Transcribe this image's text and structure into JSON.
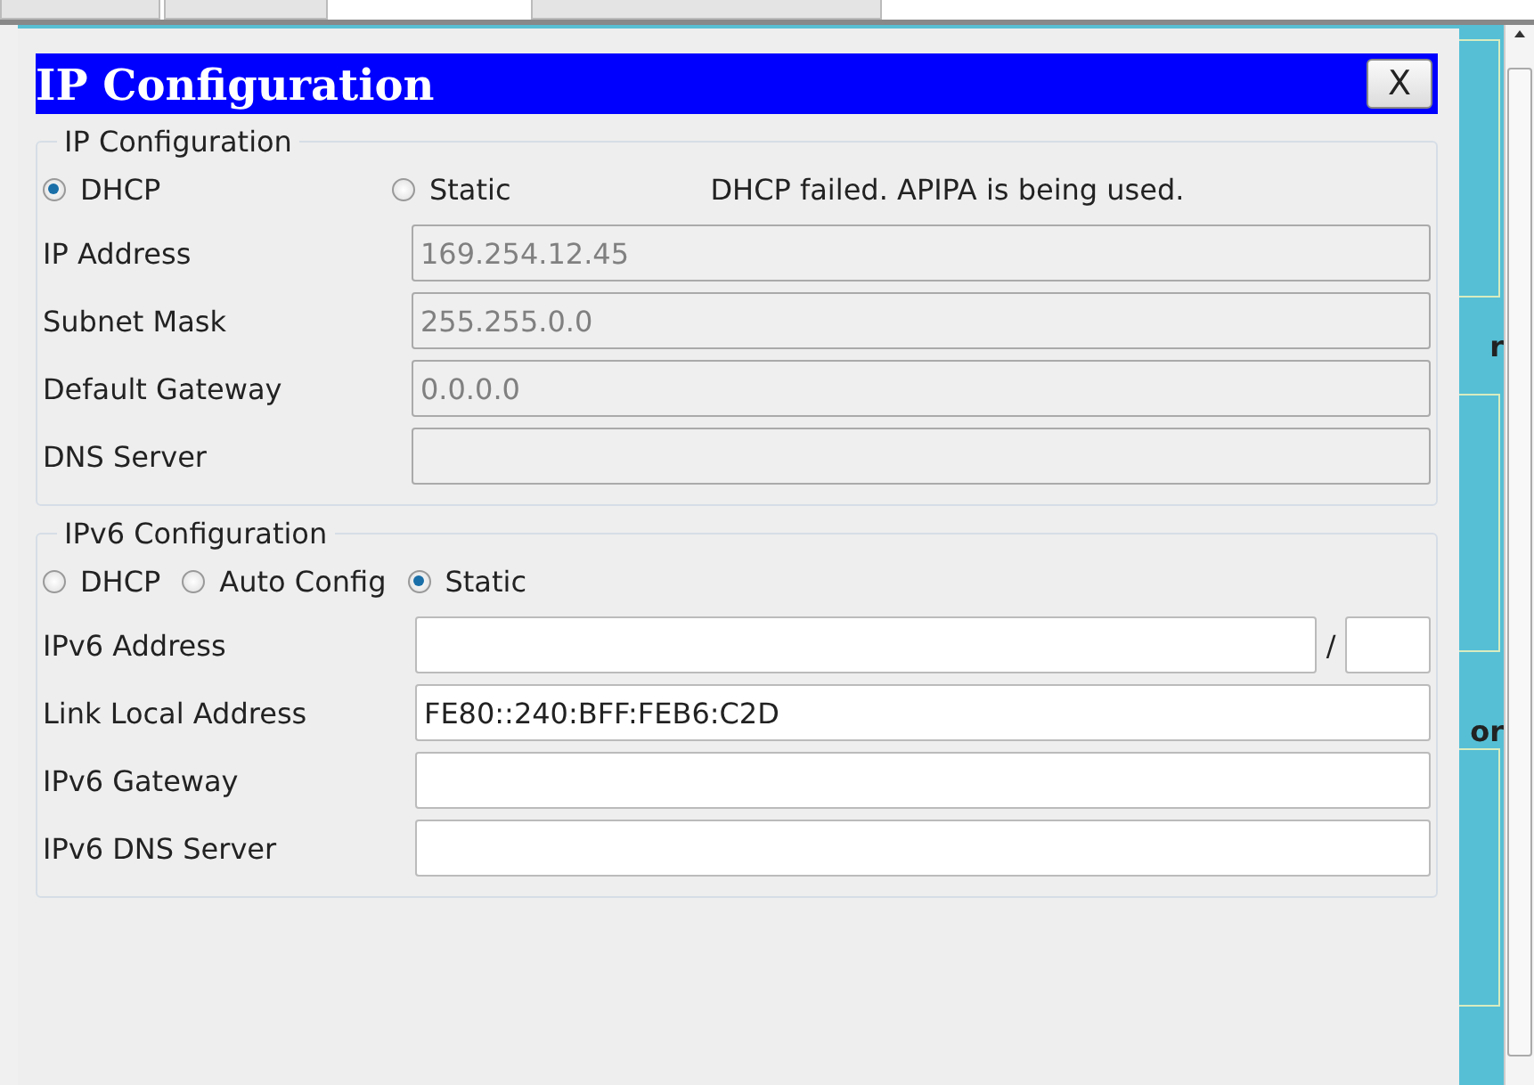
{
  "window": {
    "title": "IP Configuration",
    "close": "X"
  },
  "ipv4": {
    "title": "IP Configuration",
    "modes": [
      {
        "label": "DHCP",
        "selected": true
      },
      {
        "label": "Static",
        "selected": false
      }
    ],
    "status": "DHCP failed. APIPA is being used.",
    "fields": [
      {
        "label": "IP Address",
        "value": "169.254.12.45",
        "disabled": true
      },
      {
        "label": "Subnet Mask",
        "value": "255.255.0.0",
        "disabled": true
      },
      {
        "label": "Default Gateway",
        "value": "0.0.0.0",
        "disabled": true
      },
      {
        "label": "DNS Server",
        "disabled": true
      }
    ]
  },
  "ipv6": {
    "title": "IPv6 Configuration",
    "modes": [
      {
        "label": "DHCP",
        "selected": false
      },
      {
        "label": "Auto Config",
        "selected": false
      },
      {
        "label": "Static",
        "selected": true
      }
    ],
    "fields": [
      {
        "label": "IPv6 Address",
        "kind": "prefixed",
        "separator": "/",
        "disabled": false
      },
      {
        "label": "Link Local Address",
        "value": "FE80::240:BFF:FEB6:C2D",
        "disabled": false
      },
      {
        "label": "IPv6 Gateway",
        "disabled": false
      },
      {
        "label": "IPv6 DNS Server",
        "disabled": false
      }
    ]
  },
  "background": {
    "texts": [
      "r",
      "or"
    ]
  }
}
